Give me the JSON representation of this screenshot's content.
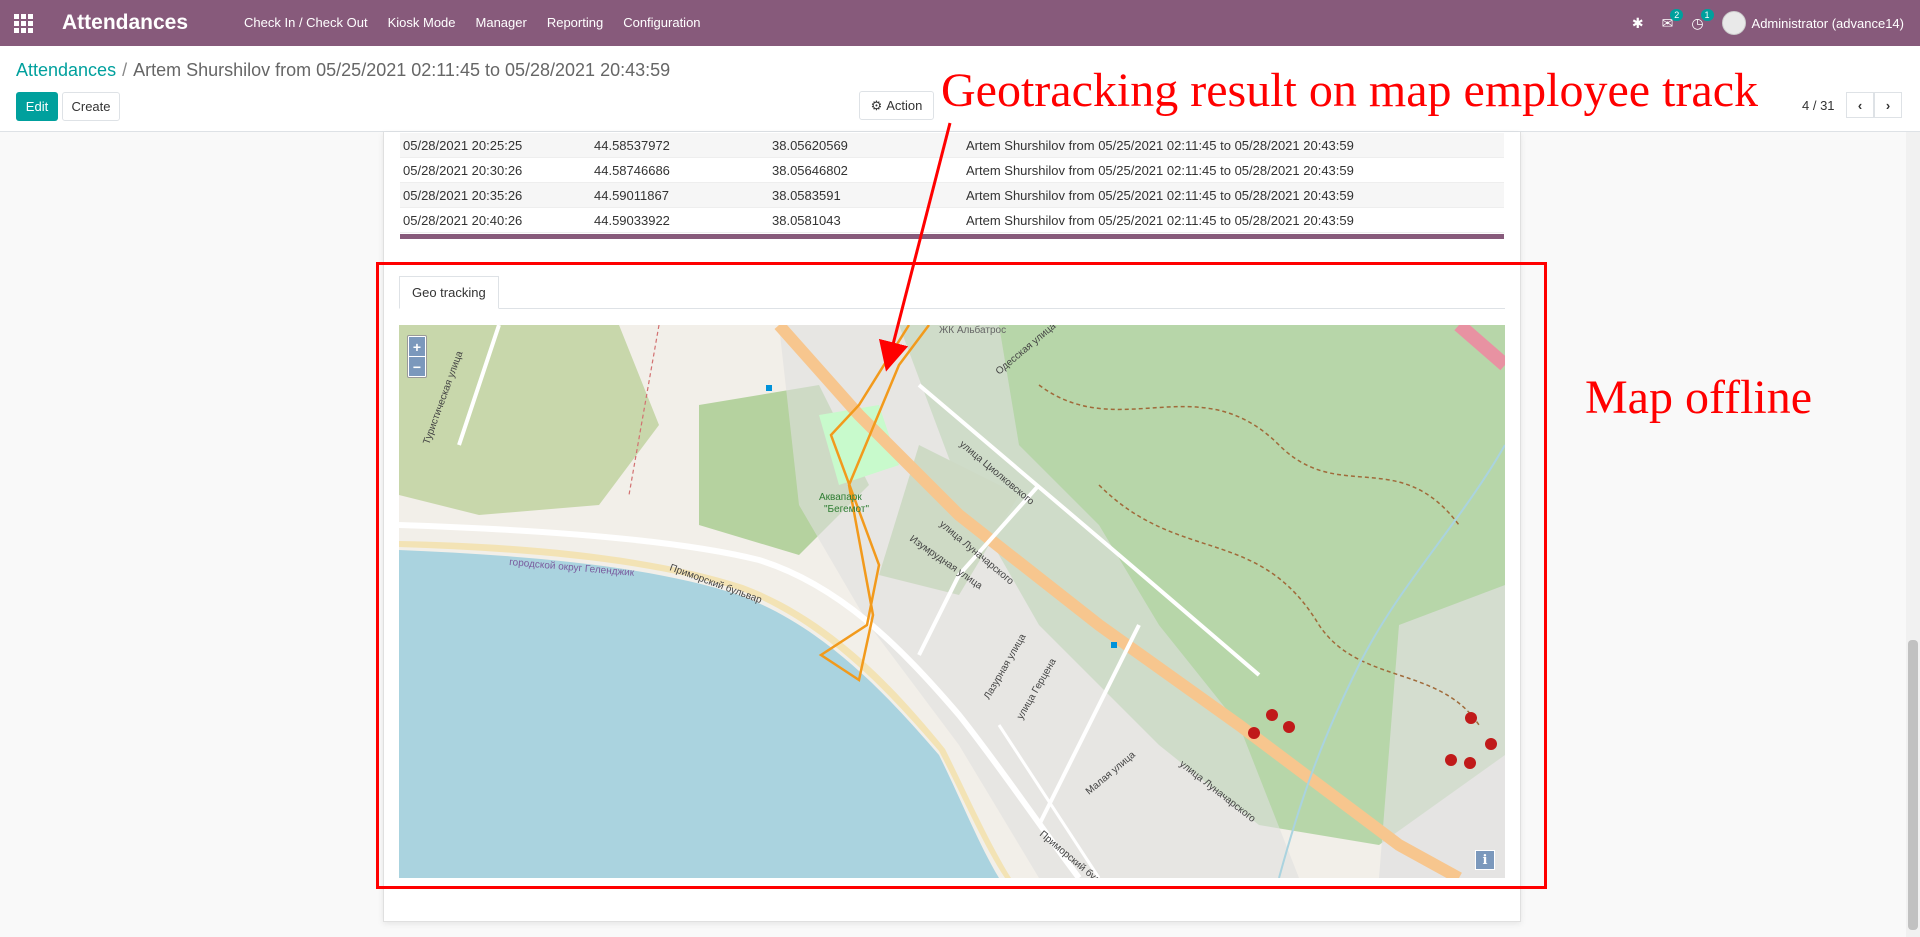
{
  "navbar": {
    "app_title": "Attendances",
    "menu": [
      "Check In / Check Out",
      "Kiosk Mode",
      "Manager",
      "Reporting",
      "Configuration"
    ],
    "messages_count": "2",
    "activities_count": "1",
    "user_name": "Administrator (advance14)"
  },
  "breadcrumb": {
    "root": "Attendances",
    "current": "Artem Shurshilov from 05/25/2021 02:11:45 to 05/28/2021 20:43:59"
  },
  "buttons": {
    "edit": "Edit",
    "create": "Create",
    "action": "Action"
  },
  "pager": {
    "text": "4 / 31"
  },
  "geo_table": {
    "rows": [
      [
        "05/28/2021 20:25:25",
        "44.58537972",
        "38.05620569",
        "Artem Shurshilov from 05/25/2021 02:11:45 to 05/28/2021 20:43:59"
      ],
      [
        "05/28/2021 20:30:26",
        "44.58746686",
        "38.05646802",
        "Artem Shurshilov from 05/25/2021 02:11:45 to 05/28/2021 20:43:59"
      ],
      [
        "05/28/2021 20:35:26",
        "44.59011867",
        "38.0583591",
        "Artem Shurshilov from 05/25/2021 02:11:45 to 05/28/2021 20:43:59"
      ],
      [
        "05/28/2021 20:40:26",
        "44.59033922",
        "38.0581043",
        "Artem Shurshilov from 05/25/2021 02:11:45 to 05/28/2021 20:43:59"
      ]
    ]
  },
  "tabs": {
    "geo_tracking": "Geo tracking"
  },
  "map": {
    "zoom_in": "+",
    "zoom_out": "−",
    "info": "i",
    "labels": {
      "park": "Аквапарк",
      "park2": "\"Бегемот\"",
      "street1": "улица Луначарского",
      "street2": "Приморский бульвар",
      "street3": "улица Циолковского",
      "street4": "Туристическая улица",
      "street5": "Изумрудная улица",
      "street6": "Лазурная улица",
      "street7": "улица Герцена",
      "street8": "Малая улица",
      "district": "городской округ Геленджик",
      "complex": "ЖК Альбатрос",
      "street9": "Одесская улица"
    },
    "water_color": "#aad3df",
    "land_color": "#f2efe9",
    "forest_color": "#add19e",
    "road_color": "#f7c68e",
    "track_color": "#f29a1c"
  },
  "annotations": {
    "title": "Geotracking result on map employee track",
    "side": "Map offline"
  }
}
